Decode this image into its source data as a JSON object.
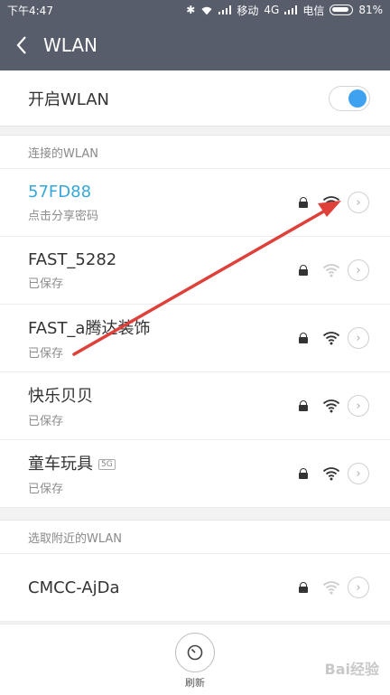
{
  "status_bar": {
    "time": "下午4:47",
    "carrier1": "移动",
    "network": "4G",
    "carrier2": "电信",
    "battery": "81%"
  },
  "app_bar": {
    "back_icon": "chevron-left-icon",
    "title": "WLAN"
  },
  "wlan_toggle": {
    "label": "开启WLAN",
    "enabled": true,
    "accent_color": "#3fa2f0"
  },
  "connected_section": {
    "header": "连接的WLAN"
  },
  "saved_networks": [
    {
      "name": "57FD88",
      "status": "点击分享密码",
      "connected": true,
      "badge": "",
      "signal": "strong"
    },
    {
      "name": "FAST_5282",
      "status": "已保存",
      "connected": false,
      "badge": "",
      "signal": "weak"
    },
    {
      "name": "FAST_a腾达装饰",
      "status": "已保存",
      "connected": false,
      "badge": "",
      "signal": "strong"
    },
    {
      "name": "快乐贝贝",
      "status": "已保存",
      "connected": false,
      "badge": "",
      "signal": "strong"
    },
    {
      "name": "童车玩具",
      "status": "已保存",
      "connected": false,
      "badge": "5G",
      "signal": "strong"
    }
  ],
  "nearby_section": {
    "header": "选取附近的WLAN"
  },
  "nearby_networks": [
    {
      "name": "CMCC-AjDa",
      "signal": "weak"
    }
  ],
  "bottom_bar": {
    "refresh_label": "刷新",
    "watermark": "Bai经验"
  },
  "colors": {
    "header_bg": "#585d6b",
    "connected_text": "#36a7d9",
    "annotation_arrow": "#e0403a"
  }
}
